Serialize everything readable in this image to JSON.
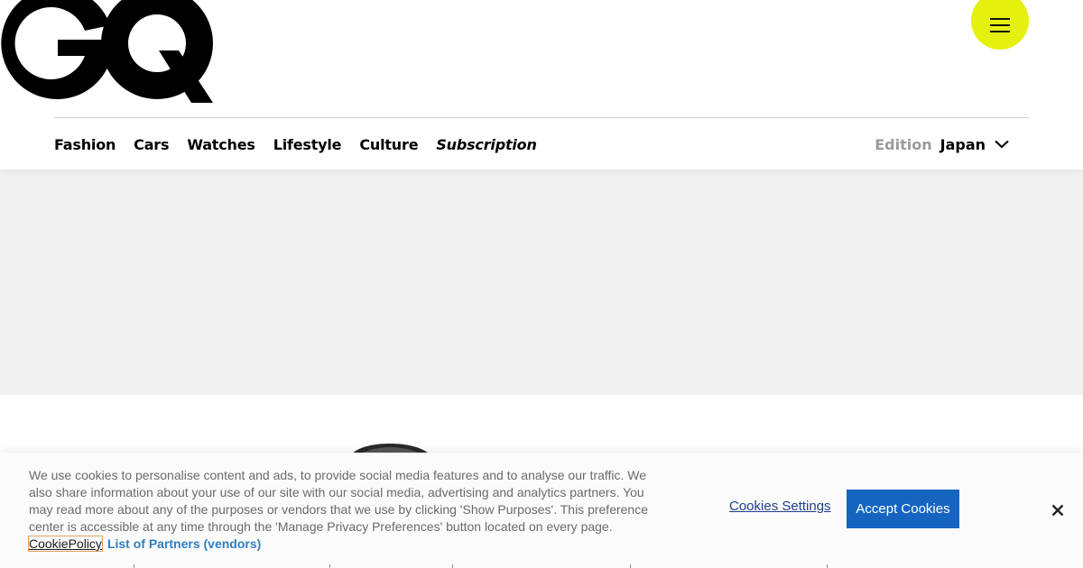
{
  "header": {
    "logo_text": "GQ",
    "menu_icon": "hamburger-icon",
    "accent_color": "#e5f00f"
  },
  "nav": {
    "items": [
      {
        "label": "Fashion"
      },
      {
        "label": "Cars"
      },
      {
        "label": "Watches"
      },
      {
        "label": "Lifestyle"
      },
      {
        "label": "Culture"
      },
      {
        "label": "Subscription"
      }
    ]
  },
  "edition": {
    "label": "Edition",
    "value": "Japan",
    "icon": "chevron-down-icon"
  },
  "cookie_banner": {
    "text": "We use cookies to personalise content and ads, to provide social media features and to analyse our traffic. We also share information about your use of our site with our social media, advertising and analytics partners. You may read more about any of the purposes or vendors that we use by clicking 'Show Purposes'. This preference center is accessible at any time through the 'Manage Privacy Preferences' button located on every page.",
    "policy_link": "CookiePolicy",
    "partners_link": "List of Partners (vendors)",
    "settings_label": "Cookies Settings",
    "accept_label": "Accept Cookies",
    "close_icon": "close-icon",
    "accept_color": "#1565c0"
  }
}
